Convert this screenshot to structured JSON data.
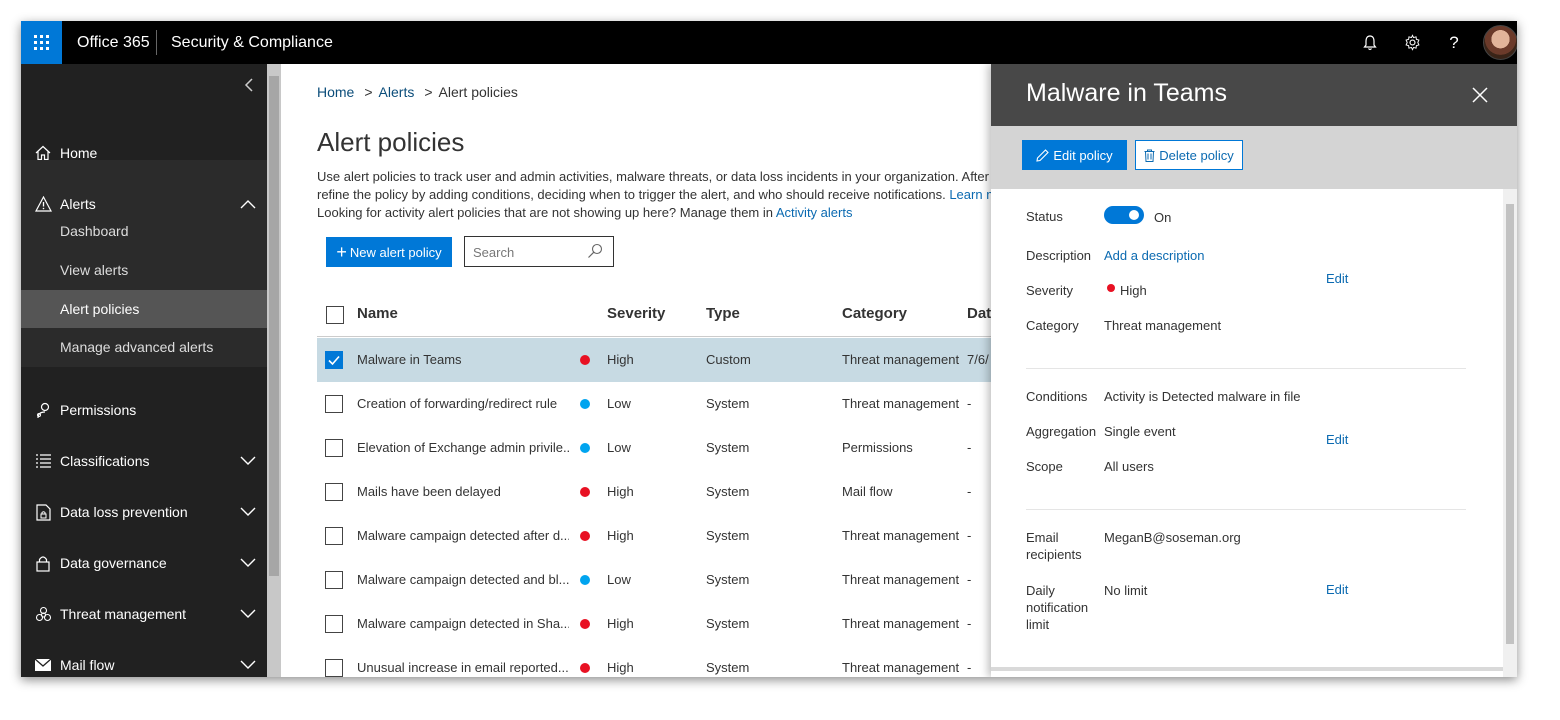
{
  "topbar": {
    "app_name": "Office 365",
    "product_name": "Security & Compliance",
    "icons": [
      "waffle-icon",
      "bell-icon",
      "gear-icon",
      "help-icon"
    ],
    "help_glyph": "?"
  },
  "nav": {
    "items": [
      {
        "label": "Home",
        "icon": "home-icon"
      },
      {
        "label": "Alerts",
        "icon": "warning-icon"
      },
      {
        "label": "Permissions",
        "icon": "people-icon"
      },
      {
        "label": "Classifications",
        "icon": "list-icon"
      },
      {
        "label": "Data loss prevention",
        "icon": "document-lock-icon"
      },
      {
        "label": "Data governance",
        "icon": "lock-icon"
      },
      {
        "label": "Threat management",
        "icon": "biohazard-icon"
      },
      {
        "label": "Mail flow",
        "icon": "mail-icon"
      }
    ],
    "alerts_sub": [
      "Dashboard",
      "View alerts",
      "Alert policies",
      "Manage advanced alerts"
    ],
    "active_sub": "Alert policies"
  },
  "breadcrumb": {
    "home": "Home",
    "alerts": "Alerts",
    "current": "Alert policies",
    "sep": ">"
  },
  "page": {
    "title": "Alert policies",
    "intro_line1": "Use alert policies to track user and admin activities, malware threats, or data loss incidents in your organization. After choosing",
    "intro_line2_pre": "refine the policy by adding conditions, deciding when to trigger the alert, and who should receive notifications. ",
    "intro_line2_link": "Learn more a",
    "intro_line3_pre": "Looking for activity alert policies that are not showing up here? Manage them in ",
    "intro_line3_link": "Activity alerts"
  },
  "toolbar": {
    "new_label": "New alert policy",
    "plus": "+",
    "search_placeholder": "Search"
  },
  "table": {
    "columns": [
      "Name",
      "Severity",
      "Type",
      "Category",
      "Date"
    ],
    "rows": [
      {
        "name": "Malware in Teams",
        "severity": "High",
        "type": "Custom",
        "category": "Threat management",
        "date": "7/6/",
        "selected": true
      },
      {
        "name": "Creation of forwarding/redirect rule",
        "severity": "Low",
        "type": "System",
        "category": "Threat management",
        "date": "-"
      },
      {
        "name": "Elevation of Exchange admin privile...",
        "severity": "Low",
        "type": "System",
        "category": "Permissions",
        "date": "-"
      },
      {
        "name": "Mails have been delayed",
        "severity": "High",
        "type": "System",
        "category": "Mail flow",
        "date": "-"
      },
      {
        "name": "Malware campaign detected after d...",
        "severity": "High",
        "type": "System",
        "category": "Threat management",
        "date": "-"
      },
      {
        "name": "Malware campaign detected and bl...",
        "severity": "Low",
        "type": "System",
        "category": "Threat management",
        "date": "-"
      },
      {
        "name": "Malware campaign detected in Sha...",
        "severity": "High",
        "type": "System",
        "category": "Threat management",
        "date": "-"
      },
      {
        "name": "Unusual increase in email reported...",
        "severity": "High",
        "type": "System",
        "category": "Threat management",
        "date": "-"
      }
    ],
    "severity_colors": {
      "High": "#e81123",
      "Low": "#00a4ef"
    }
  },
  "panel": {
    "title": "Malware in Teams",
    "edit_label": "Edit policy",
    "delete_label": "Delete policy",
    "status_label": "Status",
    "status_value": "On",
    "description_label": "Description",
    "description_value": "Add a description",
    "severity_label": "Severity",
    "severity_value": "High",
    "category_label": "Category",
    "category_value": "Threat management",
    "conditions_label": "Conditions",
    "conditions_value": "Activity is Detected malware in file",
    "aggregation_label": "Aggregation",
    "aggregation_value": "Single event",
    "scope_label": "Scope",
    "scope_value": "All users",
    "email_label_1": "Email",
    "email_label_2": "recipients",
    "email_value": "MeganB@soseman.org",
    "limit_label_1": "Daily",
    "limit_label_2": "notification",
    "limit_label_3": "limit",
    "limit_value": "No limit",
    "edit_link": "Edit"
  },
  "colors": {
    "accent": "#0078d7",
    "high": "#e81123",
    "low": "#00a4ef",
    "selected_row": "#c7dae3"
  }
}
